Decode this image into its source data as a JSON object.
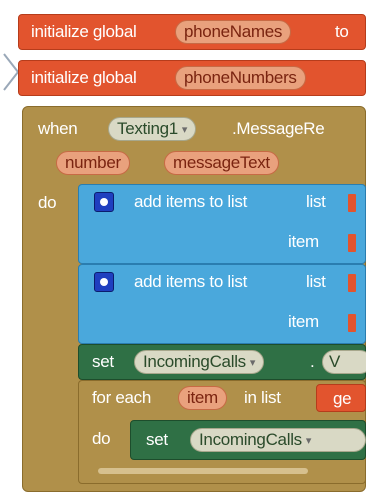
{
  "globals": {
    "row1": {
      "prefix": "initialize global",
      "var": "phoneNames",
      "suffix": "to"
    },
    "row2": {
      "prefix": "initialize global",
      "var": "phoneNumbers"
    }
  },
  "event": {
    "when": "when",
    "component": "Texting1",
    "event_name": ".MessageRe",
    "params": [
      "number",
      "messageText"
    ],
    "do": "do"
  },
  "add_block_1": {
    "label": "add items to list",
    "list": "list",
    "item": "item"
  },
  "add_block_2": {
    "label": "add items to list",
    "list": "list",
    "item": "item"
  },
  "set_block": {
    "set": "set",
    "target": "IncomingCalls",
    "dot": ".",
    "prop": "V"
  },
  "foreach": {
    "for_each": "for each",
    "var": "item",
    "in_list": "in list",
    "get": "ge",
    "do": "do"
  },
  "inner_set": {
    "set": "set",
    "target": "IncomingCalls"
  },
  "colors": {
    "orange": "#e2542e",
    "tan": "#b0904a",
    "blue": "#4aa8dc",
    "green": "#2f7045"
  }
}
